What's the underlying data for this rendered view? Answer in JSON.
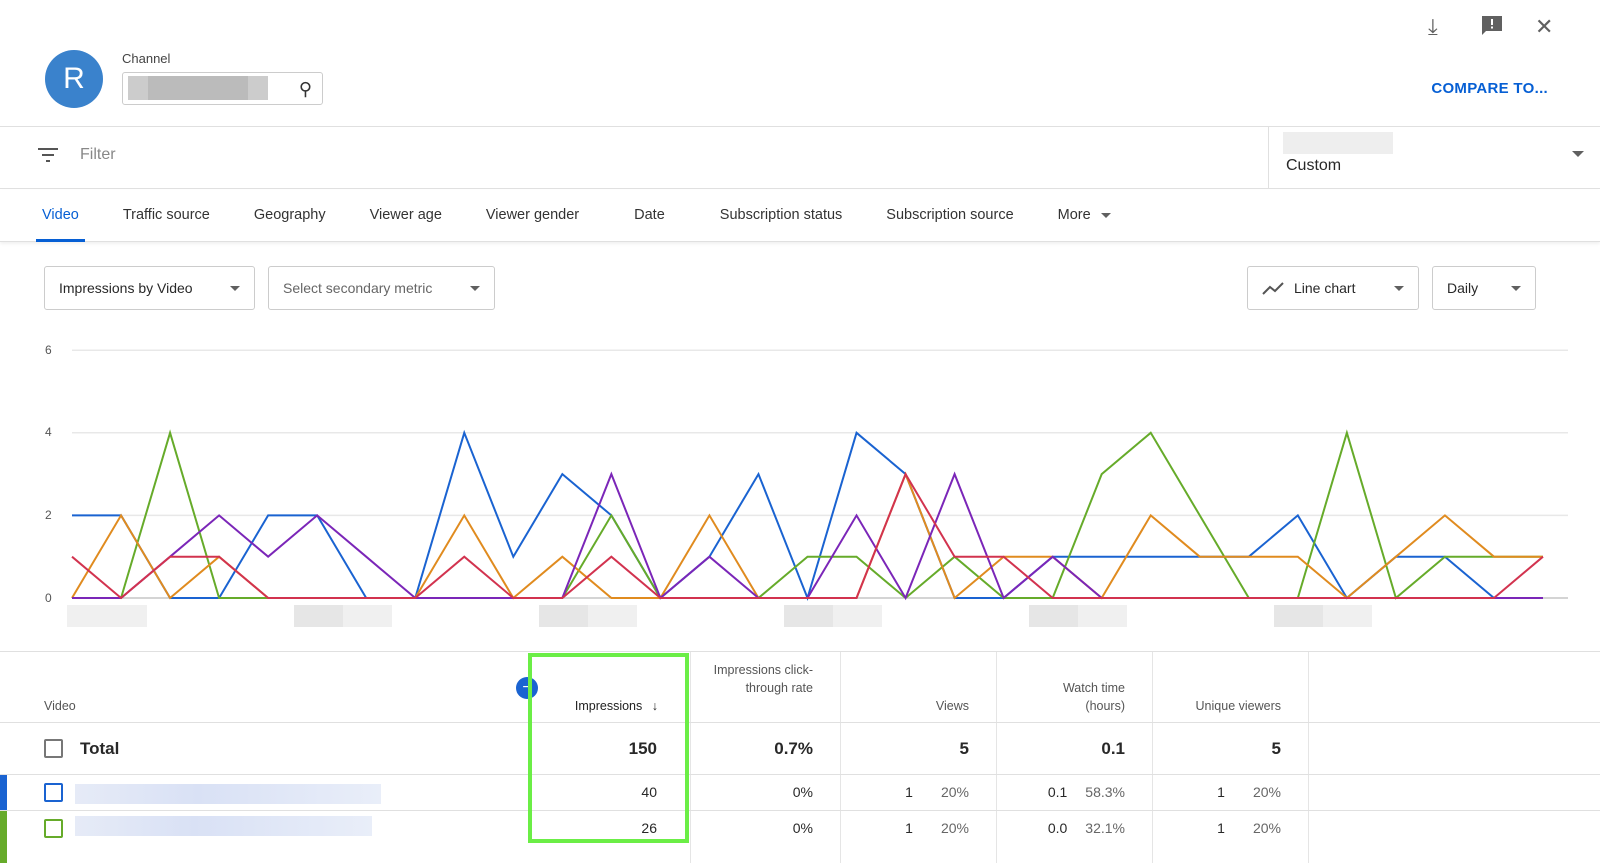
{
  "header": {
    "avatar_letter": "R",
    "channel_label": "Channel",
    "compare_label": "COMPARE TO...",
    "icons": [
      "download-icon",
      "feedback-icon",
      "close-icon"
    ]
  },
  "filter": {
    "placeholder": "Filter",
    "date_range": "Custom"
  },
  "tabs": [
    "Video",
    "Traffic source",
    "Geography",
    "Viewer age",
    "Viewer gender",
    "Date",
    "Subscription status",
    "Subscription source",
    "More"
  ],
  "controls": {
    "primary_metric": "Impressions by Video",
    "secondary_metric": "Select secondary metric",
    "chart_type": "Line chart",
    "interval": "Daily"
  },
  "chart_data": {
    "type": "line",
    "yticks": [
      "0",
      "2",
      "4",
      "6"
    ],
    "ylim": [
      0,
      6
    ],
    "grid": true,
    "series": [
      {
        "color": "#1a63d1",
        "values": [
          2,
          2,
          0,
          0,
          2,
          2,
          0,
          0,
          4,
          1,
          3,
          2,
          0,
          1,
          3,
          0,
          4,
          3,
          0,
          0,
          1,
          1,
          1,
          1,
          1,
          2,
          0,
          1,
          1,
          0,
          0
        ]
      },
      {
        "color": "#66ab2a",
        "values": [
          0,
          0,
          4,
          0,
          0,
          0,
          0,
          0,
          0,
          0,
          0,
          2,
          0,
          0,
          0,
          1,
          1,
          0,
          1,
          0,
          0,
          3,
          4,
          2,
          0,
          0,
          4,
          0,
          1,
          1,
          1
        ]
      },
      {
        "color": "#e08b1f",
        "values": [
          0,
          2,
          0,
          1,
          0,
          0,
          0,
          0,
          2,
          0,
          1,
          0,
          0,
          2,
          0,
          0,
          0,
          3,
          0,
          1,
          1,
          0,
          2,
          1,
          1,
          1,
          0,
          1,
          2,
          1,
          1
        ]
      },
      {
        "color": "#7b26b8",
        "values": [
          0,
          0,
          1,
          2,
          1,
          2,
          1,
          0,
          0,
          0,
          0,
          3,
          0,
          1,
          0,
          0,
          2,
          0,
          3,
          0,
          1,
          0,
          0,
          0,
          0,
          0,
          0,
          0,
          0,
          0,
          0
        ]
      },
      {
        "color": "#d2334f",
        "values": [
          1,
          0,
          1,
          1,
          0,
          0,
          0,
          0,
          1,
          0,
          0,
          1,
          0,
          0,
          0,
          0,
          0,
          3,
          1,
          1,
          0,
          0,
          0,
          0,
          0,
          0,
          0,
          0,
          0,
          0,
          1
        ]
      }
    ]
  },
  "table": {
    "headers": {
      "video": "Video",
      "impressions": "Impressions",
      "ctr": "Impressions click-through rate",
      "views": "Views",
      "watch": "Watch time (hours)",
      "unique": "Unique viewers"
    },
    "total": {
      "label": "Total",
      "impressions": "150",
      "ctr": "0.7%",
      "views": "5",
      "watch": "0.1",
      "unique": "5"
    },
    "rows": [
      {
        "color": "#1a63d1",
        "impressions": "40",
        "ctr": "0%",
        "views": "1",
        "views_pct": "20%",
        "watch": "0.1",
        "watch_pct": "58.3%",
        "unique": "1",
        "unique_pct": "20%"
      },
      {
        "color": "#66ab2a",
        "impressions": "26",
        "ctr": "0%",
        "views": "1",
        "views_pct": "20%",
        "watch": "0.0",
        "watch_pct": "32.1%",
        "unique": "1",
        "unique_pct": "20%"
      }
    ]
  }
}
